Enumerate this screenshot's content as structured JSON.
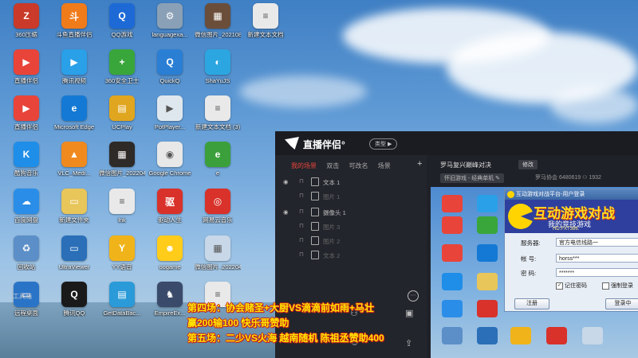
{
  "desktop": {
    "icons": [
      {
        "label": "360压缩",
        "glyph": "Z",
        "color": "#c93a2a",
        "icon": "archive-icon"
      },
      {
        "label": "斗鱼直播伴侣",
        "glyph": "斗",
        "color": "#f07b1a",
        "icon": "douyu-icon"
      },
      {
        "label": "QQ游戏",
        "glyph": "Q",
        "color": "#1d6ad6",
        "icon": "qq-game-icon"
      },
      {
        "label": "languagexa...",
        "glyph": "⚙",
        "color": "#8aa0b6",
        "icon": "settings-file-icon"
      },
      {
        "label": "微信图片_2021080...",
        "glyph": "▦",
        "color": "#6b4e3a",
        "icon": "image-file-icon"
      },
      {
        "label": "新建文本文档",
        "glyph": "≡",
        "color": "#e9e9e9",
        "icon": "text-file-icon"
      },
      {
        "label": "直播伴侣",
        "glyph": "▶",
        "color": "#e8443a",
        "icon": "live-companion-icon"
      },
      {
        "label": "腾讯视频",
        "glyph": "▶",
        "color": "#2aa0e8",
        "icon": "tencent-video-icon"
      },
      {
        "label": "360安全卫士",
        "glyph": "+",
        "color": "#39a63b",
        "icon": "security-guard-icon"
      },
      {
        "label": "QuickQ",
        "glyph": "Q",
        "color": "#2a7fd4",
        "icon": "quickq-icon"
      },
      {
        "label": "ShaYuJS",
        "glyph": "◐",
        "color": "#2ca6e0",
        "icon": "shayu-icon"
      },
      {
        "label": "直播伴侣",
        "glyph": "▶",
        "color": "#e8443a",
        "icon": "live-companion-icon"
      },
      {
        "label": "Microsoft Edge",
        "glyph": "e",
        "color": "#1479d4",
        "icon": "edge-browser-icon"
      },
      {
        "label": "UCPlay",
        "glyph": "▤",
        "color": "#e0a61f",
        "icon": "ucplay-icon"
      },
      {
        "label": "PotPlayer...",
        "glyph": "▶",
        "color": "#dfe7ee",
        "icon": "potplayer-icon"
      },
      {
        "label": "新建文本文档 (3)",
        "glyph": "≡",
        "color": "#e9e9e9",
        "icon": "text-file-icon"
      },
      {
        "label": "酷狗音乐",
        "glyph": "K",
        "color": "#1e8ee8",
        "icon": "kugou-music-icon"
      },
      {
        "label": "VLC_Medi...",
        "glyph": "▲",
        "color": "#f08a1e",
        "icon": "vlc-icon"
      },
      {
        "label": "微信图片_2022040...",
        "glyph": "▦",
        "color": "#2e2a28",
        "icon": "image-file-icon"
      },
      {
        "label": "Google Chrome",
        "glyph": "◉",
        "color": "#e8e8e8",
        "icon": "chrome-icon"
      },
      {
        "label": "e",
        "glyph": "e",
        "color": "#3ba03b",
        "icon": "app-e-icon"
      },
      {
        "label": "百度网盘",
        "glyph": "☁",
        "color": "#2a8ee8",
        "icon": "baidu-netdisk-icon"
      },
      {
        "label": "新建文件夹",
        "glyph": "▭",
        "color": "#e8c65a",
        "icon": "folder-icon"
      },
      {
        "label": "lnk",
        "glyph": "≡",
        "color": "#e9e9e9",
        "icon": "shortcut-file-icon"
      },
      {
        "label": "驱动人生",
        "glyph": "驱",
        "color": "#d8322a",
        "icon": "driver-icon"
      },
      {
        "label": "网易云音乐",
        "glyph": "◎",
        "color": "#d8322a",
        "icon": "netease-music-icon"
      },
      {
        "label": "回收站",
        "glyph": "♻",
        "color": "#5c8fc8",
        "icon": "recycle-bin-icon"
      },
      {
        "label": "UltraViewer",
        "glyph": "▭",
        "color": "#2a6fb8",
        "icon": "ultraviewer-icon"
      },
      {
        "label": "YY语音",
        "glyph": "Y",
        "color": "#f0b41a",
        "icon": "yy-voice-icon"
      },
      {
        "label": "oogame",
        "glyph": "☻",
        "color": "#ffcc1a",
        "icon": "oogame-icon"
      },
      {
        "label": "微信图片_2022040...",
        "glyph": "▦",
        "color": "#c8d8e8",
        "icon": "image-file-icon"
      },
      {
        "label": "远程桌面",
        "glyph": "▭",
        "color": "#2a74c8",
        "icon": "remote-desktop-icon"
      },
      {
        "label": "腾讯QQ",
        "glyph": "Q",
        "color": "#1a1a1a",
        "icon": "qq-icon"
      },
      {
        "label": "GetDataBac...",
        "glyph": "▤",
        "color": "#2a9ad8",
        "icon": "getdataback-icon"
      },
      {
        "label": "EmpireEx...",
        "glyph": "♞",
        "color": "#3a4a6a",
        "icon": "empire-icon"
      },
      {
        "label": "",
        "glyph": "≡",
        "color": "#e9e9e9",
        "icon": "text-file-icon"
      }
    ]
  },
  "app": {
    "title": "直播伴侣°",
    "type_button": "类型 ▶",
    "tabs": [
      "我的场景",
      "双击",
      "可改名",
      "场景"
    ],
    "layers": [
      {
        "name": "文本 1",
        "dim": false
      },
      {
        "name": "图片 1",
        "dim": true
      },
      {
        "name": "摄像头 1",
        "dim": false
      },
      {
        "name": "图片 3",
        "dim": true
      },
      {
        "name": "图片 2",
        "dim": true
      },
      {
        "name": "文本 2",
        "dim": true
      }
    ],
    "tools_label": "工具箱",
    "stream_title": "罗马复兴巅峰对决",
    "edit_label": "修改",
    "game_tag": "怀旧游戏 - 经典单机 ✎",
    "room_info": "罗马协会  6480619  ⚇ 1932"
  },
  "dialog": {
    "title": "互动游戏对战平台-用户登录",
    "banner_title": "互动游戏对战",
    "banner_sub": "我的竞技游戏",
    "banner_url": "HD.FXT386.",
    "server_label": "服务器:",
    "server_value": "官方电信线路一",
    "account_label": "帐  号:",
    "account_value": "horss***",
    "password_label": "密  码:",
    "password_value": "*******",
    "remember_label": "记住密码",
    "force_login_label": "强制登录",
    "register_label": "注册",
    "login_label": "登录中"
  },
  "overlay": {
    "line1": "第四场：协会赌圣+大厨VS滴滴前如雨+马壮",
    "line2": "赢200输100 快乐哥赞助",
    "line3": "第五场：二少VS火海 越南随机 陈祖丞赞助400"
  }
}
